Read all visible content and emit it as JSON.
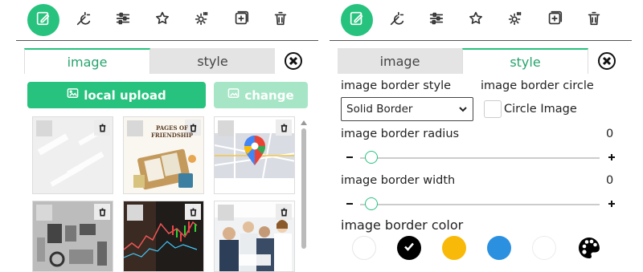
{
  "toolbar": {
    "buttons": [
      {
        "name": "edit-image",
        "icon": "edit-image-icon",
        "active": true
      },
      {
        "name": "effects",
        "icon": "magic-icon",
        "active": false
      },
      {
        "name": "adjust",
        "icon": "sliders-icon",
        "active": false
      },
      {
        "name": "favorite",
        "icon": "star-icon",
        "active": false
      },
      {
        "name": "settings",
        "icon": "gear-icon",
        "active": false
      },
      {
        "name": "add",
        "icon": "add-square-icon",
        "active": false
      },
      {
        "name": "delete",
        "icon": "trash-icon",
        "active": false
      }
    ]
  },
  "left": {
    "tabs": [
      {
        "label": "image",
        "active": true
      },
      {
        "label": "style",
        "active": false
      }
    ],
    "local_upload_label": "local upload",
    "change_label": "change",
    "images": [
      {
        "name": "white-texture",
        "kind": "texture"
      },
      {
        "name": "pages-of-friendship",
        "kind": "book",
        "title": "PAGES OF FRIENDSHIP"
      },
      {
        "name": "google-map",
        "kind": "map"
      },
      {
        "name": "gadgets-desk",
        "kind": "desk"
      },
      {
        "name": "stock-chart",
        "kind": "chart"
      },
      {
        "name": "business-meeting",
        "kind": "people"
      }
    ]
  },
  "right": {
    "tabs": [
      {
        "label": "image",
        "active": false
      },
      {
        "label": "style",
        "active": true
      }
    ],
    "border_style_label": "image border style",
    "border_style_value": "Solid Border",
    "border_circle_label": "image border circle",
    "circle_image_label": "Circle Image",
    "border_radius_label": "image border radius",
    "border_radius_value": "0",
    "border_width_label": "image border width",
    "border_width_value": "0",
    "border_color_label": "image border color",
    "colors": [
      {
        "name": "white",
        "hex": "#ffffff",
        "selected": false
      },
      {
        "name": "black",
        "hex": "#000000",
        "selected": true
      },
      {
        "name": "amber",
        "hex": "#f8b908",
        "selected": false
      },
      {
        "name": "blue",
        "hex": "#2b90e0",
        "selected": false
      },
      {
        "name": "light",
        "hex": "#ffffff",
        "selected": false
      }
    ]
  },
  "accent_color": "#27c27d"
}
